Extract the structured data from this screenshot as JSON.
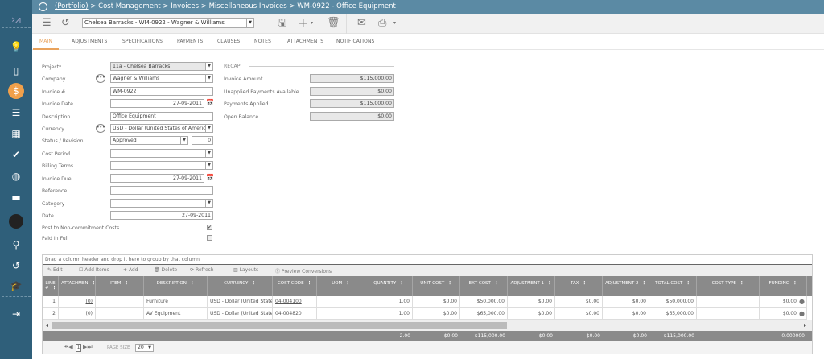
{
  "header": {
    "portfolio_link": "(Portfolio)",
    "breadcrumb_rest": " > Cost Management > Invoices > Miscellaneous Invoices > WM-0922 - Office Equipment"
  },
  "toolbar": {
    "record_selector": "Chelsea Barracks - WM-0922 - Wagner & Williams"
  },
  "tabs": [
    "MAIN",
    "ADJUSTMENTS",
    "SPECIFICATIONS",
    "PAYMENTS",
    "CLAUSES",
    "NOTES",
    "ATTACHMENTS",
    "NOTIFICATIONS"
  ],
  "form": {
    "project_label": "Project*",
    "project": "11a - Chelsea Barracks",
    "company_label": "Company",
    "company": "Wagner & Williams",
    "invoice_no_label": "Invoice #",
    "invoice_no": "WM-0922",
    "invoice_date_label": "Invoice Date",
    "invoice_date": "27-09-2011",
    "description_label": "Description",
    "description": "Office Equipment",
    "currency_label": "Currency",
    "currency": "USD - Dollar (United States of America)",
    "status_label": "Status / Revision",
    "status": "Approved",
    "revision": "0",
    "cost_period_label": "Cost Period",
    "cost_period": "",
    "billing_terms_label": "Billing Terms",
    "billing_terms": "",
    "invoice_due_label": "Invoice Due",
    "invoice_due": "27-09-2011",
    "reference_label": "Reference",
    "reference": "",
    "category_label": "Category",
    "category": "",
    "date_label": "Date",
    "date": "27-09-2011",
    "post_label": "Post to Non-commitment Costs",
    "post_checked": true,
    "paid_label": "Paid In Full",
    "paid_checked": false
  },
  "recap": {
    "title": "RECAP",
    "invoice_amount_label": "Invoice Amount",
    "invoice_amount": "$115,000.00",
    "unapplied_label": "Unapplied Payments Available",
    "unapplied": "$0.00",
    "applied_label": "Payments Applied",
    "applied": "$115,000.00",
    "open_label": "Open Balance",
    "open": "$0.00"
  },
  "grid": {
    "group_hint": "Drag a column header and drop it here to group by that column",
    "toolbar": [
      "Edit",
      "Add Items",
      "Add",
      "Delete",
      "Refresh",
      "Layouts",
      "Preview Conversions"
    ],
    "columns": [
      "LINE #",
      "ATTACHMEN",
      "ITEM",
      "DESCRIPTION",
      "CURRENCY",
      "COST CODE",
      "UOM",
      "QUANTITY",
      "UNIT COST",
      "EXT COST",
      "ADJUSTMENT 1",
      "TAX",
      "ADJUSTMENT 2",
      "TOTAL COST",
      "COST TYPE",
      "FUNDING"
    ],
    "rows": [
      [
        "1",
        "(0)",
        "",
        "Furniture",
        "USD - Dollar (United States of America)",
        "04-004100",
        "",
        "1.00",
        "$0.00",
        "$50,000.00",
        "$0.00",
        "$0.00",
        "$0.00",
        "$50,000.00",
        "",
        "$0.00"
      ],
      [
        "2",
        "(0)",
        "",
        "AV Equipment",
        "USD - Dollar (United States of America)",
        "04-004820",
        "",
        "1.00",
        "$0.00",
        "$65,000.00",
        "$0.00",
        "$0.00",
        "$0.00",
        "$65,000.00",
        "",
        "$0.00"
      ]
    ],
    "totals": [
      "",
      "",
      "",
      "",
      "",
      "",
      "",
      "2.00",
      "$0.00",
      "$115,000.00",
      "$0.00",
      "$0.00",
      "$0.00",
      "$115,000.00",
      "",
      "0.000000"
    ],
    "pager": {
      "page": "1",
      "page_size_label": "PAGE SIZE",
      "page_size": "20"
    }
  },
  "colors": {
    "sidebar": "#2f5f7a",
    "header": "#5b8aa4",
    "accent": "#e9a25b",
    "grid_header": "#8a8a8a"
  }
}
